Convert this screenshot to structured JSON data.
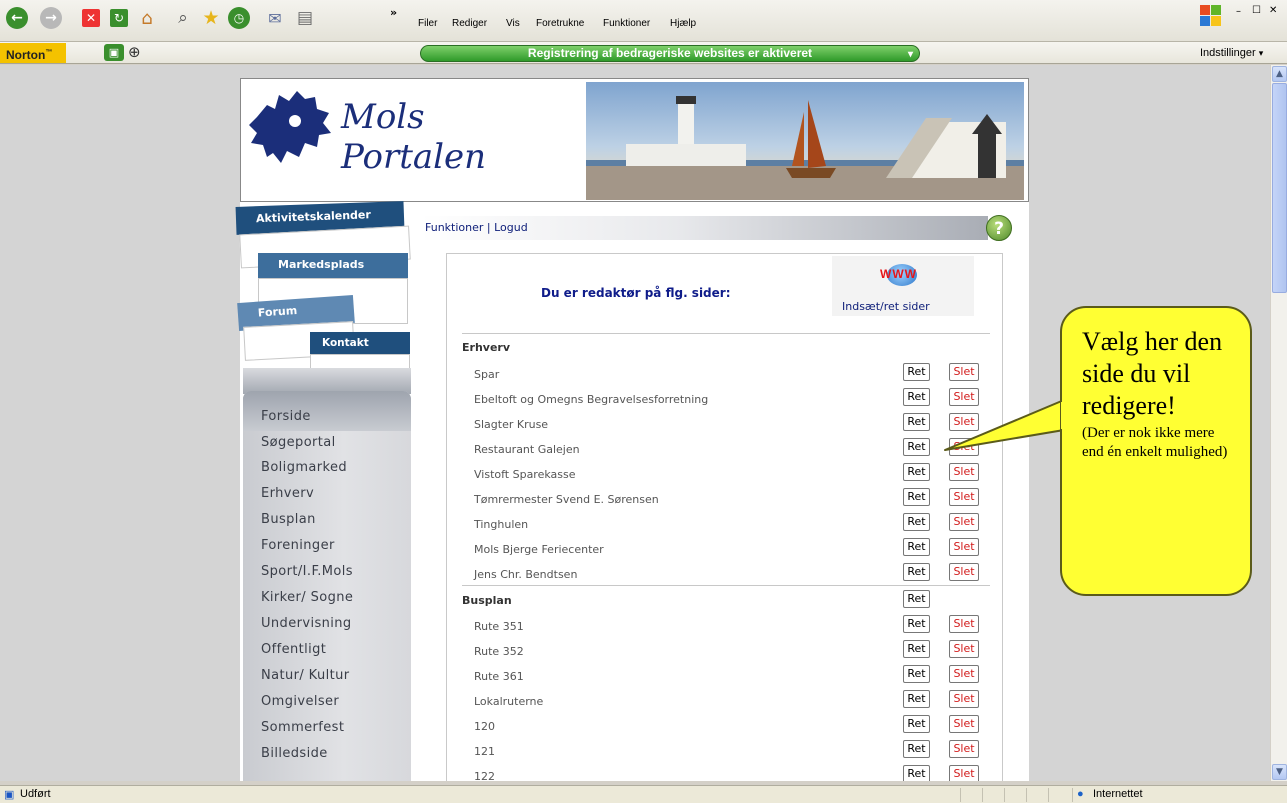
{
  "browser": {
    "menu": [
      "Filer",
      "Rediger",
      "Vis",
      "Foretrukne",
      "Funktioner",
      "Hjælp"
    ],
    "chevron": "»",
    "norton_label": "Norton",
    "norton_status": "Registrering af bedrageriske websites er aktiveret",
    "settings_label": "Indstillinger",
    "window_controls": [
      "–",
      "☐",
      "✕"
    ]
  },
  "header": {
    "logo_line1": "Mols",
    "logo_line2": "Portalen"
  },
  "tabs": {
    "aktivitetskalender": "Aktivitetskalender",
    "markedsplads": "Markedsplads",
    "forum": "Forum",
    "kontakt": "Kontakt"
  },
  "nav": {
    "items": [
      "Forside",
      "Søgeportal",
      "Boligmarked",
      "Erhverv",
      "Busplan",
      "Foreninger",
      "Sport/I.F.Mols",
      "Kirker/ Sogne",
      "Undervisning",
      "Offentligt",
      "Natur/ Kultur",
      "Omgivelser",
      "Sommerfest",
      "Billedside"
    ]
  },
  "functions": {
    "funktioner": "Funktioner",
    "separator": "|",
    "logud": "Logud",
    "help": "?"
  },
  "content": {
    "heading": "Du er redaktør på flg. sider:",
    "www": "WWW",
    "insert_link": "Indsæt/ret sider",
    "ret": "Ret",
    "slet": "Slet",
    "sections": [
      {
        "title": "Erhverv",
        "rows": [
          "Spar",
          "Ebeltoft og Omegns Begravelsesforretning",
          "Slagter Kruse",
          "Restaurant Galejen",
          "Vistoft Sparekasse",
          "Tømrermester Svend E. Sørensen",
          "Tinghulen",
          "Mols Bjerge Feriecenter",
          "Jens Chr. Bendtsen"
        ]
      },
      {
        "title": "Busplan",
        "rows": [
          "Rute 351",
          "Rute 352",
          "Rute 361",
          "Lokalruterne",
          "120",
          "121",
          "122"
        ]
      }
    ]
  },
  "callout": {
    "main": "Vælg her den side du vil redigere!",
    "sub": "(Der er nok ikke mere end én enkelt mulighed)"
  },
  "statusbar": {
    "left": "Udført",
    "zone": "Internettet"
  },
  "colors": {
    "accent_blue": "#1f4f7d",
    "link_blue": "#10207a",
    "slet_red": "#d21a1a",
    "callout_yellow": "#ffff33"
  }
}
